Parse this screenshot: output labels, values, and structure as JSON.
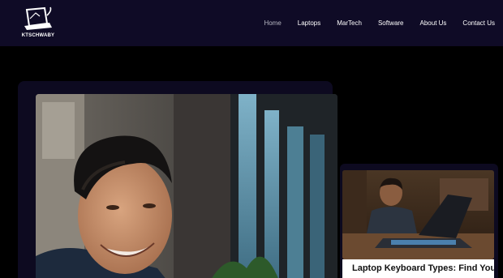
{
  "brand": {
    "name": "KTSCHWABY"
  },
  "nav": {
    "items": [
      {
        "label": "Home",
        "active": true
      },
      {
        "label": "Laptops",
        "active": false
      },
      {
        "label": "MarTech",
        "active": false
      },
      {
        "label": "Software",
        "active": false
      },
      {
        "label": "About Us",
        "active": false
      },
      {
        "label": "Contact Us",
        "active": false
      }
    ]
  },
  "featured_card": {
    "title": "Laptop Keyboard Types: Find Your"
  },
  "colors": {
    "header_bg": "#0f0b26",
    "page_bg": "#000000",
    "panel_bg": "#0d0a20",
    "nav_text": "#ffffff",
    "nav_active": "#b7b7c2"
  }
}
